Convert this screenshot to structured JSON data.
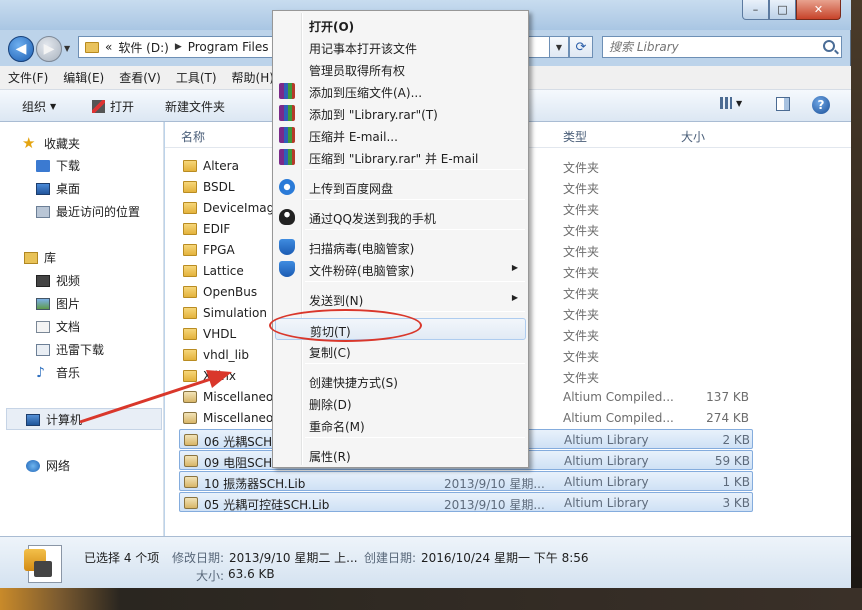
{
  "window": {
    "controls": [
      "–",
      "□",
      "✕"
    ]
  },
  "address": {
    "segments": [
      "«",
      "软件 (D:)",
      "Program Files"
    ],
    "search_placeholder": "搜索 Library"
  },
  "menubar": [
    "文件(F)",
    "编辑(E)",
    "查看(V)",
    "工具(T)",
    "帮助(H)"
  ],
  "toolbar": {
    "organize": "组织",
    "open": "打开",
    "new_folder": "新建文件夹"
  },
  "navpane": {
    "favorites": "收藏夹",
    "downloads": "下载",
    "desktop": "桌面",
    "recent": "最近访问的位置",
    "libraries": "库",
    "videos": "视频",
    "pictures": "图片",
    "documents": "文档",
    "xunlei": "迅雷下载",
    "music": "音乐",
    "computer": "计算机",
    "network": "网络"
  },
  "columns": {
    "name": "名称",
    "type": "类型",
    "size": "大小"
  },
  "files": [
    {
      "name": "Altera",
      "date": "期...",
      "type": "文件夹",
      "size": "",
      "kind": "folder",
      "selected": false
    },
    {
      "name": "BSDL",
      "date": "期...",
      "type": "文件夹",
      "size": "",
      "kind": "folder",
      "selected": false
    },
    {
      "name": "DeviceImage",
      "date": "期...",
      "type": "文件夹",
      "size": "",
      "kind": "folder",
      "selected": false
    },
    {
      "name": "EDIF",
      "date": "期...",
      "type": "文件夹",
      "size": "",
      "kind": "folder",
      "selected": false
    },
    {
      "name": "FPGA",
      "date": "期...",
      "type": "文件夹",
      "size": "",
      "kind": "folder",
      "selected": false
    },
    {
      "name": "Lattice",
      "date": "期...",
      "type": "文件夹",
      "size": "",
      "kind": "folder",
      "selected": false
    },
    {
      "name": "OpenBus",
      "date": "期...",
      "type": "文件夹",
      "size": "",
      "kind": "folder",
      "selected": false
    },
    {
      "name": "Simulation",
      "date": "期...",
      "type": "文件夹",
      "size": "",
      "kind": "folder",
      "selected": false
    },
    {
      "name": "VHDL",
      "date": "期...",
      "type": "文件夹",
      "size": "",
      "kind": "folder",
      "selected": false
    },
    {
      "name": "vhdl_lib",
      "date": "期...",
      "type": "文件夹",
      "size": "",
      "kind": "folder",
      "selected": false
    },
    {
      "name": "Xilinx",
      "date": "期...",
      "type": "文件夹",
      "size": "",
      "kind": "folder",
      "selected": false
    },
    {
      "name": "Miscellaneo",
      "date": "期...",
      "type": "Altium Compiled...",
      "size": "137 KB",
      "kind": "lib",
      "selected": false
    },
    {
      "name": "Miscellaneo",
      "date": "期...",
      "type": "Altium Compiled...",
      "size": "274 KB",
      "kind": "lib",
      "selected": false
    },
    {
      "name": "06 光耦SCH.",
      "date": "期...",
      "type": "Altium Library",
      "size": "2 KB",
      "kind": "lib",
      "selected": true
    },
    {
      "name": "09 电阻SCH.",
      "date": "二 ...",
      "type": "Altium Library",
      "size": "59 KB",
      "kind": "lib",
      "selected": true
    },
    {
      "name": "10 振荡器SCH.Lib",
      "date": "2013/9/10 星期...",
      "type": "Altium Library",
      "size": "1 KB",
      "kind": "lib",
      "selected": true
    },
    {
      "name": "05 光耦可控硅SCH.Lib",
      "date": "2013/9/10 星期...",
      "type": "Altium Library",
      "size": "3 KB",
      "kind": "lib",
      "selected": true
    }
  ],
  "details": {
    "selected": "已选择 4 个项",
    "modified_label": "修改日期:",
    "modified": "2013/9/10 星期二 上...",
    "created_label": "创建日期:",
    "created": "2016/10/24 星期一 下午 8:56",
    "size_label": "大小:",
    "size": "63.6 KB"
  },
  "context_menu": [
    {
      "label": "打开(O)",
      "icon": "",
      "bold": true
    },
    {
      "label": "用记事本打开该文件",
      "icon": ""
    },
    {
      "label": "管理员取得所有权",
      "icon": ""
    },
    {
      "label": "添加到压缩文件(A)...",
      "icon": "winrar-icon"
    },
    {
      "label": "添加到 \"Library.rar\"(T)",
      "icon": "winrar-icon"
    },
    {
      "label": "压缩并 E-mail...",
      "icon": "winrar-icon"
    },
    {
      "label": "压缩到 \"Library.rar\" 并 E-mail",
      "icon": "winrar-icon"
    },
    {
      "label": "上传到百度网盘",
      "icon": "baidu-cloud-icon"
    },
    {
      "label": "通过QQ发送到我的手机",
      "icon": "qq-icon"
    },
    {
      "label": "扫描病毒(电脑管家)",
      "icon": "shield-icon"
    },
    {
      "label": "文件粉碎(电脑管家)",
      "icon": "shield-icon",
      "submenu": true
    },
    {
      "label": "发送到(N)",
      "icon": "",
      "submenu": true
    },
    {
      "label": "剪切(T)",
      "icon": "",
      "highlight": true
    },
    {
      "label": "复制(C)",
      "icon": ""
    },
    {
      "label": "创建快捷方式(S)",
      "icon": ""
    },
    {
      "label": "删除(D)",
      "icon": ""
    },
    {
      "label": "重命名(M)",
      "icon": ""
    },
    {
      "label": "属性(R)",
      "icon": ""
    }
  ],
  "colors": {
    "annotation": "#d9372b",
    "selection": "#cfe1f5",
    "title_bar": "#a9c6e3"
  }
}
